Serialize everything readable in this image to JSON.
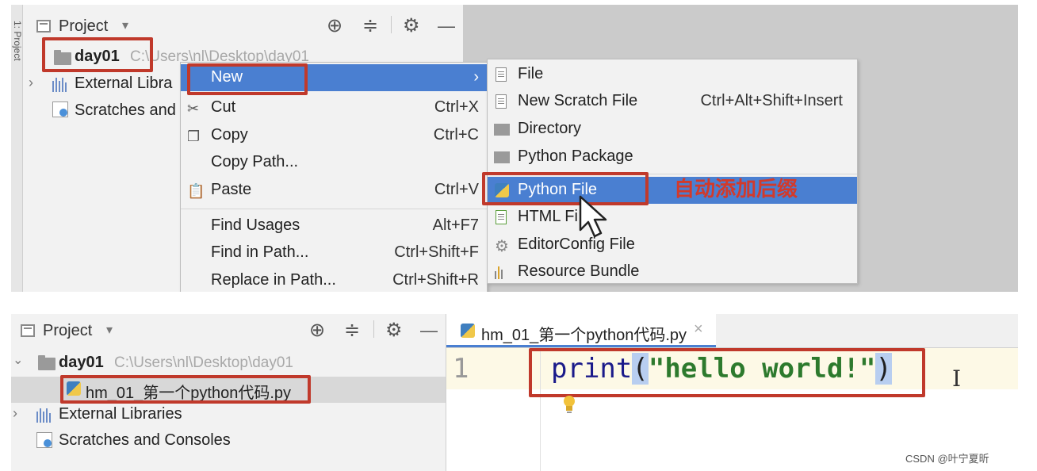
{
  "top_panel": {
    "gutter_label": "1: Project",
    "toolbar": {
      "title": "Project",
      "dropdown": "▾",
      "target_icon": "⊕",
      "collapse_icon": "≑",
      "settings_icon": "⚙",
      "minimize_icon": "—"
    },
    "tree": {
      "root_name": "day01",
      "root_path": "C:\\Users\\nl\\Desktop\\day01",
      "external_libraries": "External Libra",
      "scratches": "Scratches and"
    },
    "context_menu": {
      "items": [
        {
          "label": "New",
          "key": "",
          "icon": "",
          "arrow": "›"
        },
        {
          "label": "Cut",
          "key": "Ctrl+X",
          "icon": "✂"
        },
        {
          "label": "Copy",
          "key": "Ctrl+C",
          "icon": "❐"
        },
        {
          "label": "Copy Path...",
          "key": "",
          "icon": ""
        },
        {
          "label": "Paste",
          "key": "Ctrl+V",
          "icon": "📋"
        },
        {
          "label": "Find Usages",
          "key": "Alt+F7",
          "icon": ""
        },
        {
          "label": "Find in Path...",
          "key": "Ctrl+Shift+F",
          "icon": ""
        },
        {
          "label": "Replace in Path...",
          "key": "Ctrl+Shift+R",
          "icon": ""
        }
      ]
    },
    "submenu": {
      "items": [
        {
          "label": "File",
          "key": ""
        },
        {
          "label": "New Scratch File",
          "key": "Ctrl+Alt+Shift+Insert"
        },
        {
          "label": "Directory",
          "key": ""
        },
        {
          "label": "Python Package",
          "key": ""
        },
        {
          "label": "Python File",
          "key": ""
        },
        {
          "label": "HTML Fi",
          "key": ""
        },
        {
          "label": "EditorConfig File",
          "key": ""
        },
        {
          "label": "Resource Bundle",
          "key": ""
        }
      ]
    },
    "annotation": "自动添加后缀"
  },
  "bottom_panel": {
    "toolbar": {
      "title": "Project",
      "dropdown": "▾",
      "target_icon": "⊕",
      "collapse_icon": "≑",
      "settings_icon": "⚙",
      "minimize_icon": "—"
    },
    "tree": {
      "root_name": "day01",
      "root_path": "C:\\Users\\nl\\Desktop\\day01",
      "file_name": "hm_01_第一个python代码.py",
      "external_libraries": "External Libraries",
      "scratches": "Scratches and Consoles"
    },
    "tab": {
      "label": "hm_01_第一个python代码.py",
      "close": "×"
    },
    "editor": {
      "line_number": "1",
      "code_func": "print",
      "code_open": "(",
      "code_string": "\"hello world!\"",
      "code_close": ")",
      "text_cursor": "I"
    }
  },
  "watermark": "CSDN @叶宁夏昕",
  "colors": {
    "selection": "#4a7fd1",
    "annotation_red": "#d23a2b",
    "box_red": "#c0392b"
  }
}
